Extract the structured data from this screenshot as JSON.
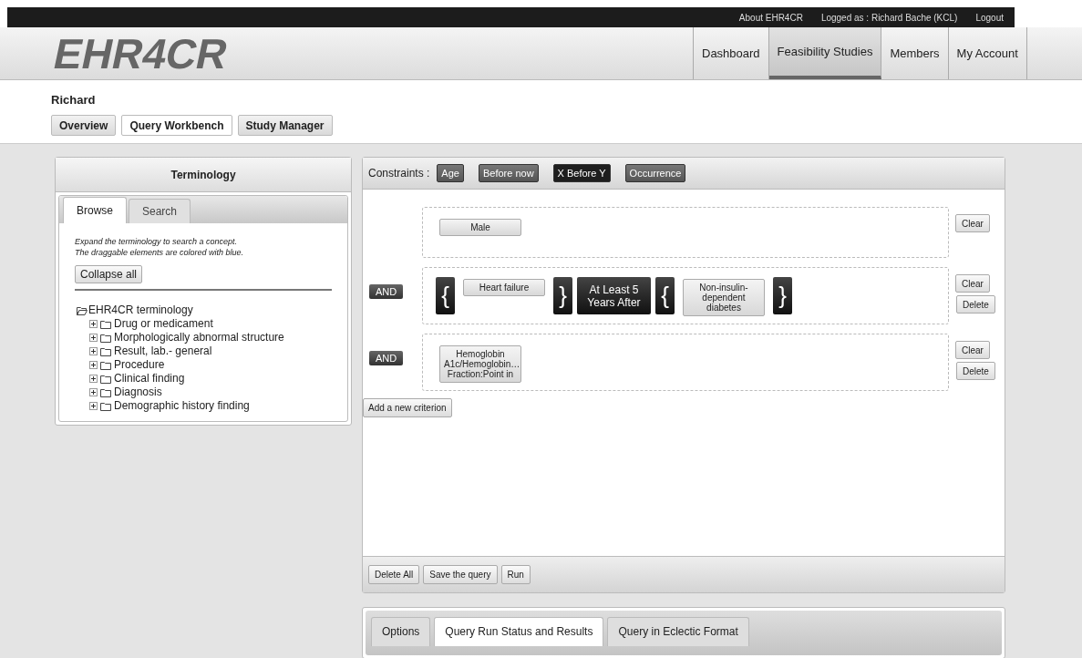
{
  "top_links": [
    "About EHR4CR",
    "Logged as : Richard Bache (KCL)",
    "Logout"
  ],
  "logo": "EHR4CR",
  "nav": [
    {
      "label": "Dashboard",
      "selected": false
    },
    {
      "label": "Feasibility Studies",
      "selected": true
    },
    {
      "label": "Members",
      "selected": false
    },
    {
      "label": "My Account",
      "selected": false
    }
  ],
  "user_name": "Richard",
  "subtabs": [
    {
      "label": "Overview",
      "selected": false
    },
    {
      "label": "Query Workbench",
      "selected": true
    },
    {
      "label": "Study Manager",
      "selected": false
    }
  ],
  "terminology": {
    "title": "Terminology",
    "tabs": [
      {
        "label": "Browse",
        "selected": true
      },
      {
        "label": "Search",
        "selected": false
      }
    ],
    "hint_lines": [
      "Expand the terminology to search a concept.",
      "The draggable elements are colored with blue."
    ],
    "collapse_button": "Collapse all",
    "tree": {
      "label": "EHR4CR terminology",
      "expanded": true,
      "children": [
        {
          "label": "Drug or medicament",
          "expanded": false
        },
        {
          "label": "Morphologically abnormal structure",
          "expanded": false
        },
        {
          "label": "Result, lab.- general",
          "expanded": false
        },
        {
          "label": "Procedure",
          "expanded": false
        },
        {
          "label": "Clinical finding",
          "expanded": false
        },
        {
          "label": "Diagnosis",
          "expanded": false
        },
        {
          "label": "Demographic history finding",
          "expanded": false
        }
      ]
    }
  },
  "query": {
    "constraints_label": "Constraints :",
    "constraints": [
      {
        "label": "Age",
        "selected": false
      },
      {
        "label": "Before now",
        "selected": false
      },
      {
        "label": "X Before Y",
        "selected": true
      },
      {
        "label": "Occurrence",
        "selected": false
      }
    ],
    "criteria": [
      {
        "items": [
          {
            "kind": "concept",
            "label": "Male"
          }
        ],
        "buttons": [
          "Clear"
        ]
      },
      {
        "operator": "AND",
        "items": [
          {
            "kind": "brace",
            "label": "{"
          },
          {
            "kind": "concept",
            "label": "Heart failure"
          },
          {
            "kind": "brace",
            "label": "}"
          },
          {
            "kind": "relation",
            "label": "At Least 5 Years After"
          },
          {
            "kind": "brace",
            "label": "{"
          },
          {
            "kind": "concept",
            "label": "Non-insulin-dependent diabetes"
          },
          {
            "kind": "brace",
            "label": "}"
          }
        ],
        "buttons": [
          "Clear",
          "Delete"
        ]
      },
      {
        "operator": "AND",
        "items": [
          {
            "kind": "concept",
            "label": "Hemoglobin A1c/Hemoglobin… Fraction:Point in"
          }
        ],
        "buttons": [
          "Clear",
          "Delete"
        ]
      }
    ],
    "add_button": "Add a new criterion",
    "actions": [
      "Delete All",
      "Save the query",
      "Run"
    ]
  },
  "result_tabs": [
    {
      "label": "Options",
      "selected": false
    },
    {
      "label": "Query Run Status and Results",
      "selected": true
    },
    {
      "label": "Query in Eclectic Format",
      "selected": false
    }
  ]
}
